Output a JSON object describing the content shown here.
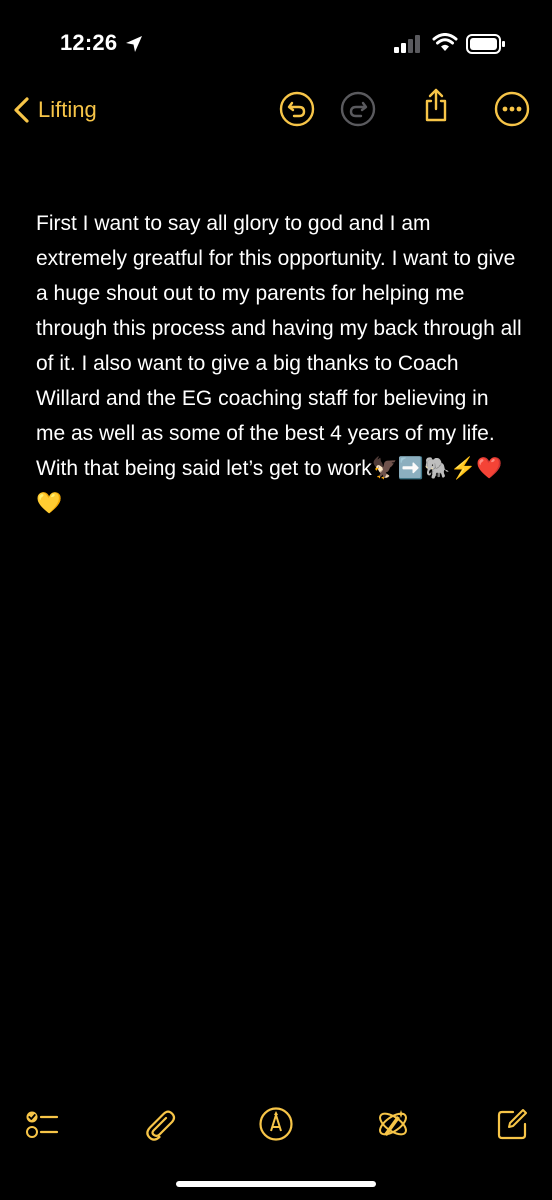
{
  "status_bar": {
    "time": "12:26",
    "icons": [
      "location-arrow-icon",
      "cellular-signal-icon",
      "wifi-icon",
      "battery-icon"
    ]
  },
  "nav": {
    "back_label": "Lifting",
    "icons": [
      "undo-icon",
      "redo-icon",
      "share-icon",
      "more-icon"
    ]
  },
  "note": {
    "body": "First I want to say all glory to god and I am extremely greatful for this opportunity. I want to give a huge shout out to my parents for helping me through this process and having my back through all of it. I also want to give a big thanks to Coach Willard and the EG coaching staff for believing in me as well as some of the best 4 years of my life. With that being said let’s get to work🦅➡️🐘⚡️❤️💛"
  },
  "toolbar": {
    "icons": [
      "checklist-icon",
      "attachment-icon",
      "markup-icon",
      "writing-tools-icon",
      "compose-icon"
    ]
  },
  "colors": {
    "accent": "#f7c548",
    "background": "#000000",
    "text": "#ffffff"
  }
}
